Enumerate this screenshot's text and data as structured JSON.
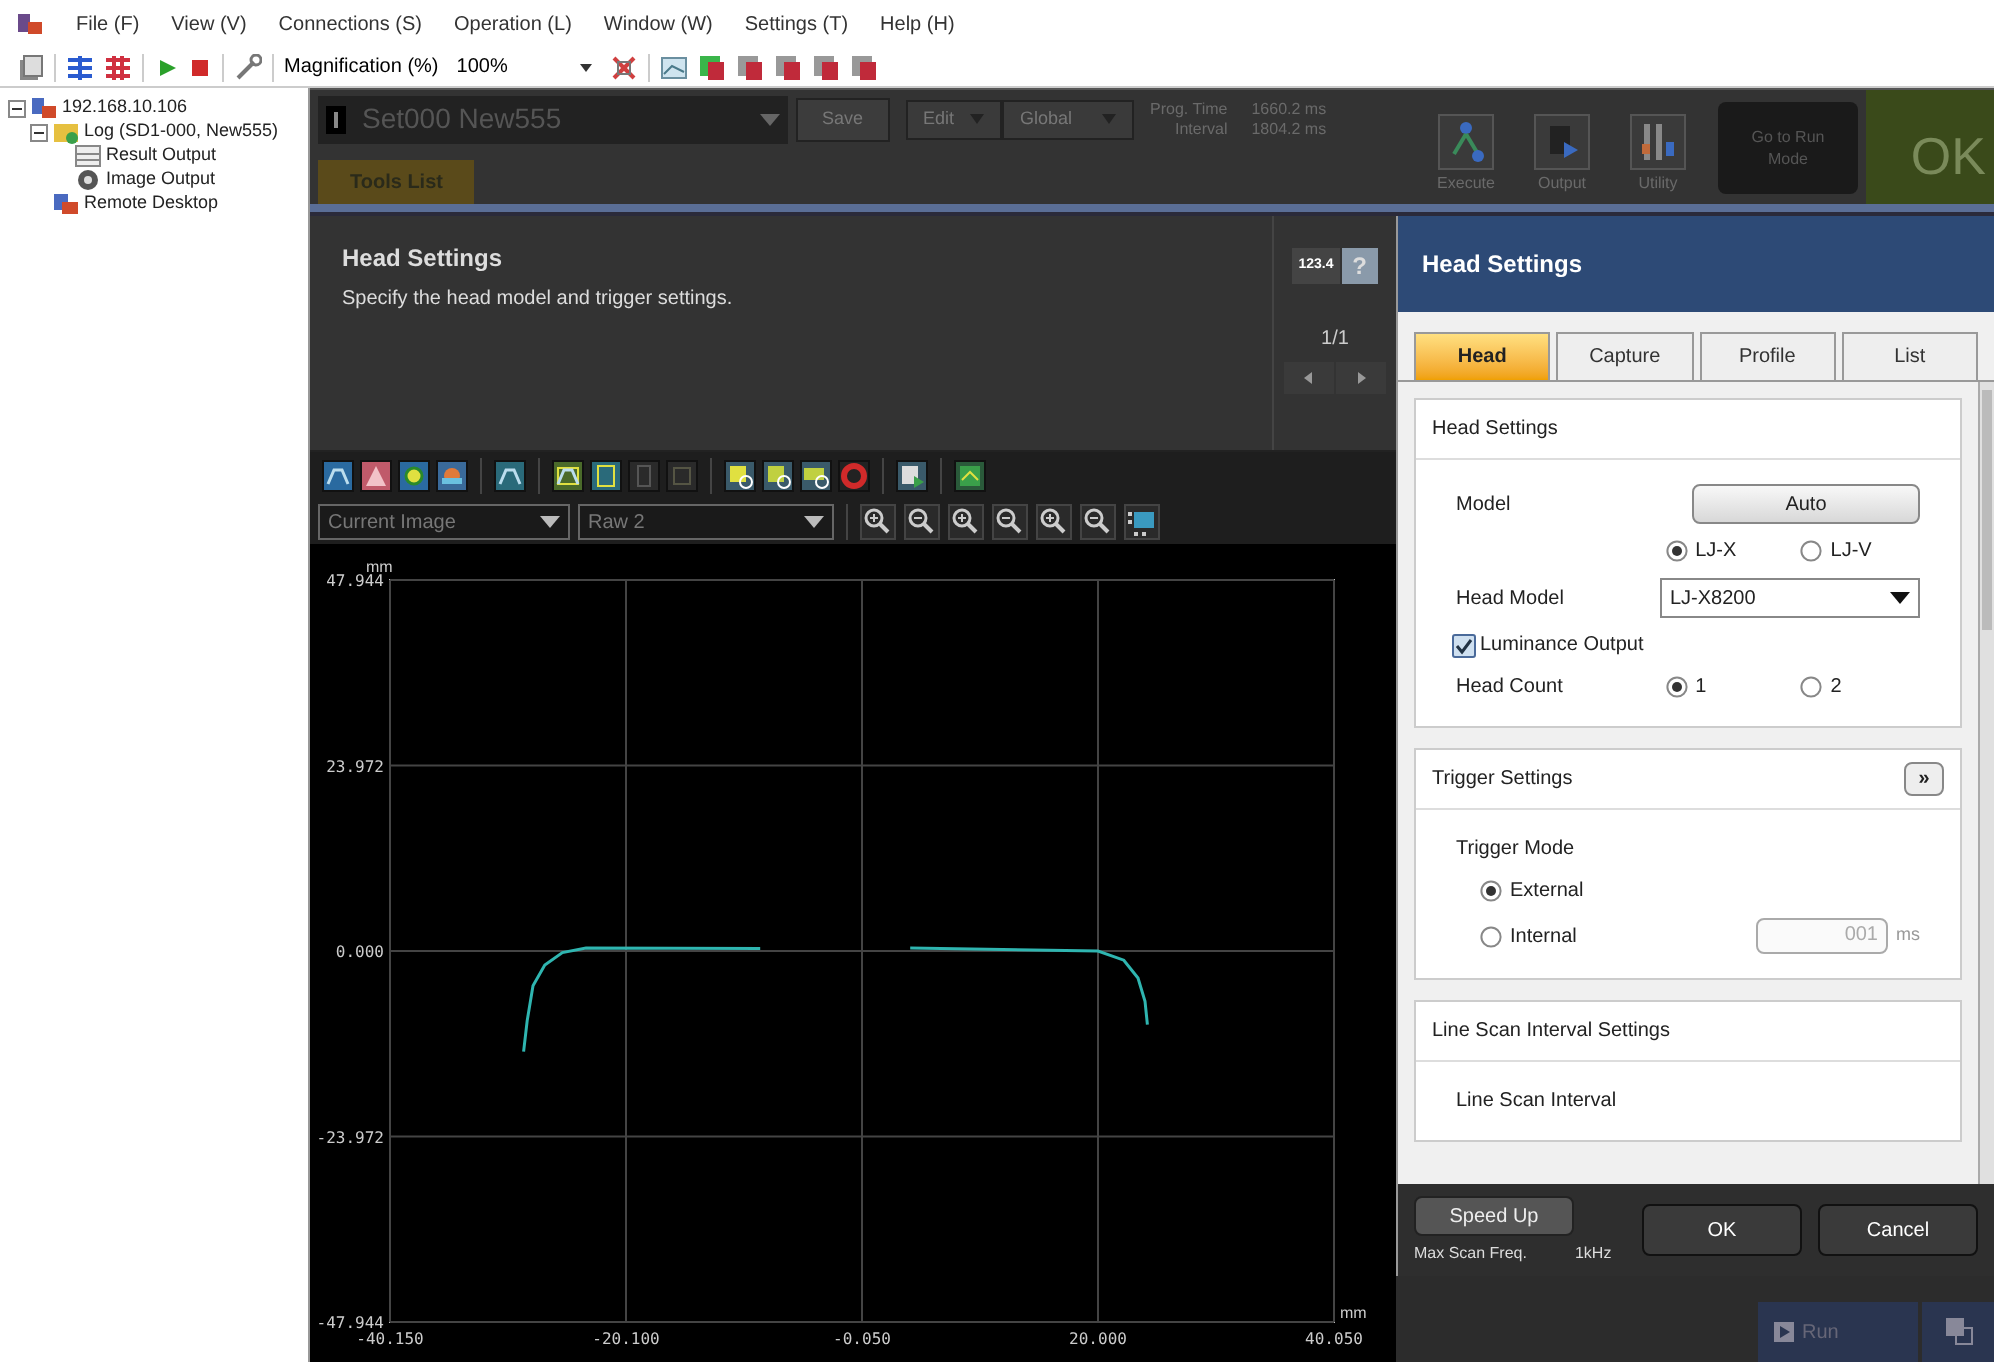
{
  "menu": [
    "File (F)",
    "View (V)",
    "Connections (S)",
    "Operation (L)",
    "Window (W)",
    "Settings (T)",
    "Help (H)"
  ],
  "toolbar": {
    "magnification_label": "Magnification (%)",
    "magnification_value": "100%"
  },
  "tree": [
    {
      "label": "192.168.10.106",
      "kind": "device",
      "expanded": true,
      "children": [
        {
          "label": "Log (SD1-000, New555)",
          "kind": "log",
          "expanded": true,
          "children": [
            {
              "label": "Result Output",
              "kind": "result"
            },
            {
              "label": "Image Output",
              "kind": "image"
            }
          ]
        },
        {
          "label": "Remote Desktop",
          "kind": "remote"
        }
      ]
    }
  ],
  "header": {
    "setting_name": "Set000 New555",
    "save": "Save",
    "menus": [
      "Edit",
      "Global"
    ],
    "times": [
      {
        "label": "Prog. Time",
        "value": "1660.2 ms"
      },
      {
        "label": "Interval",
        "value": "1804.2 ms"
      }
    ],
    "actions": [
      {
        "label": "Execute",
        "kind": "execute"
      },
      {
        "label": "Output",
        "kind": "output"
      },
      {
        "label": "Utility",
        "kind": "utility"
      }
    ],
    "run_mode": "Go to Run Mode",
    "judge": "OK"
  },
  "tabs": [
    {
      "label": "Tools List",
      "selected": true
    }
  ],
  "guide": {
    "title": "Head Settings",
    "description": "Specify the head model and trigger settings.",
    "numpad": "123.4",
    "help": "?",
    "page": "1/1"
  },
  "view": {
    "image_select": "Current Image",
    "raw_select": "Raw 2",
    "chart_data": {
      "type": "line",
      "grid": true,
      "xlabel": "mm",
      "ylabel": "mm",
      "xlim": [
        -40.15,
        40.05
      ],
      "ylim": [
        -47.944,
        47.944
      ],
      "xticks": [
        {
          "value": -40.15,
          "label": "-40.150"
        },
        {
          "value": -20.1,
          "label": "-20.100"
        },
        {
          "value": -0.05,
          "label": "-0.050"
        },
        {
          "value": 20.0,
          "label": "20.000"
        },
        {
          "value": 40.05,
          "label": "40.050"
        }
      ],
      "yticks": [
        {
          "value": 47.944,
          "label": "47.944"
        },
        {
          "value": 23.972,
          "label": "23.972"
        },
        {
          "value": 0,
          "label": "0.000"
        },
        {
          "value": -23.972,
          "label": "-23.972"
        },
        {
          "value": -47.944,
          "label": "-47.944"
        }
      ],
      "x": [
        -28.8,
        -28.5,
        -28.0,
        -27.0,
        -25.5,
        -23.5,
        -8.7,
        4.05,
        20.0,
        22.2,
        23.4,
        24.0,
        24.2
      ],
      "series": [
        {
          "color": "#2fb5b0",
          "values": [
            -13,
            -9,
            -4.5,
            -1.8,
            -0.2,
            0.4,
            0.3,
            null,
            null,
            null,
            null,
            null,
            null
          ]
        },
        {
          "color": "#2fb5b0",
          "values": [
            null,
            null,
            null,
            null,
            null,
            null,
            null,
            0.4,
            0.0,
            -1.2,
            -3.5,
            -6.5,
            -9.5
          ]
        }
      ]
    }
  },
  "dialog": {
    "title": "Head Settings",
    "tabs": [
      {
        "label": "Head",
        "selected": true
      },
      {
        "label": "Capture",
        "selected": false
      },
      {
        "label": "Profile",
        "selected": false
      },
      {
        "label": "List",
        "selected": false
      }
    ],
    "sections": [
      {
        "title": "Head Settings",
        "rows": [
          {
            "kind": "button",
            "label": "Model",
            "button": "Auto"
          },
          {
            "kind": "radios",
            "options": [
              {
                "label": "LJ-X",
                "selected": true
              },
              {
                "label": "LJ-V",
                "selected": false
              }
            ]
          },
          {
            "kind": "select",
            "label": "Head Model",
            "value": "LJ-X8200"
          },
          {
            "kind": "checkbox",
            "label": "Luminance Output",
            "checked": true
          },
          {
            "kind": "radios",
            "label": "Head Count",
            "options": [
              {
                "label": "1",
                "selected": true
              },
              {
                "label": "2",
                "selected": false
              }
            ]
          }
        ]
      },
      {
        "title": "Trigger Settings",
        "expand": "»",
        "rows": [
          {
            "kind": "text",
            "label": "Trigger Mode"
          },
          {
            "kind": "radio",
            "label": "External",
            "selected": true
          },
          {
            "kind": "radio",
            "label": "Internal",
            "selected": false,
            "value": "001",
            "unit": "ms",
            "disabled": true
          }
        ]
      },
      {
        "title": "Line Scan Interval Settings",
        "rows": [
          {
            "kind": "text",
            "label": "Line Scan Interval"
          }
        ]
      }
    ],
    "speed_up": "Speed Up",
    "max_scan_label": "Max Scan Freq.",
    "max_scan_value": "1kHz",
    "ok": "OK",
    "cancel": "Cancel"
  },
  "footer": {
    "run": "Run"
  }
}
